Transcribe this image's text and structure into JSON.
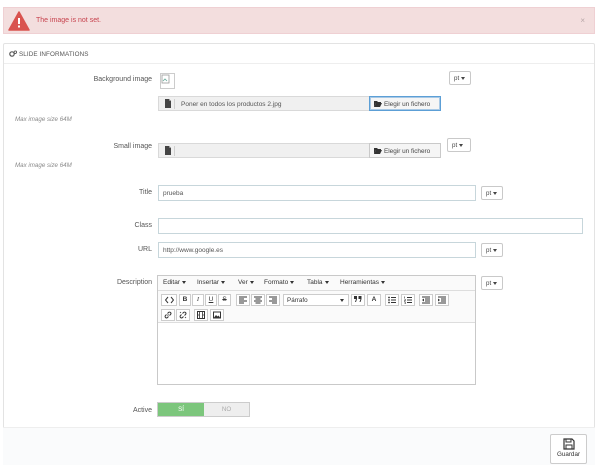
{
  "alert": {
    "message": "The image is not set.",
    "close": "×"
  },
  "panel": {
    "title": "SLIDE INFORMATIONS"
  },
  "form": {
    "background_image": {
      "label": "Background image",
      "file_name": "Poner en todos los productos 2.jpg",
      "choose_button": "Elegir un fichero",
      "lang": "pt",
      "help": "Max image size 64M"
    },
    "small_image": {
      "label": "Small image",
      "file_name": "",
      "choose_button": "Elegir un fichero",
      "lang": "pt",
      "help": "Max image size 64M"
    },
    "title": {
      "label": "Title",
      "value": "prueba",
      "lang": "pt"
    },
    "class": {
      "label": "Class",
      "value": ""
    },
    "url": {
      "label": "URL",
      "value": "http://www.google.es",
      "lang": "pt"
    },
    "description": {
      "label": "Description",
      "lang": "pt",
      "menus": [
        "Editar",
        "Insertar",
        "Ver",
        "Formato",
        "Tabla",
        "Herramientas"
      ],
      "format_select": "Párrafo",
      "toolbar_text": {
        "bold": "B",
        "italic": "I",
        "underline": "U",
        "strike": "S",
        "font_color": "A"
      }
    },
    "active": {
      "label": "Active",
      "yes": "SÍ",
      "no": "NO",
      "value": "yes"
    }
  },
  "footer": {
    "save_label": "Guardar"
  },
  "colors": {
    "alert_bg": "#f3dede",
    "alert_text": "#c7424d",
    "switch_on": "#7cc67c"
  }
}
